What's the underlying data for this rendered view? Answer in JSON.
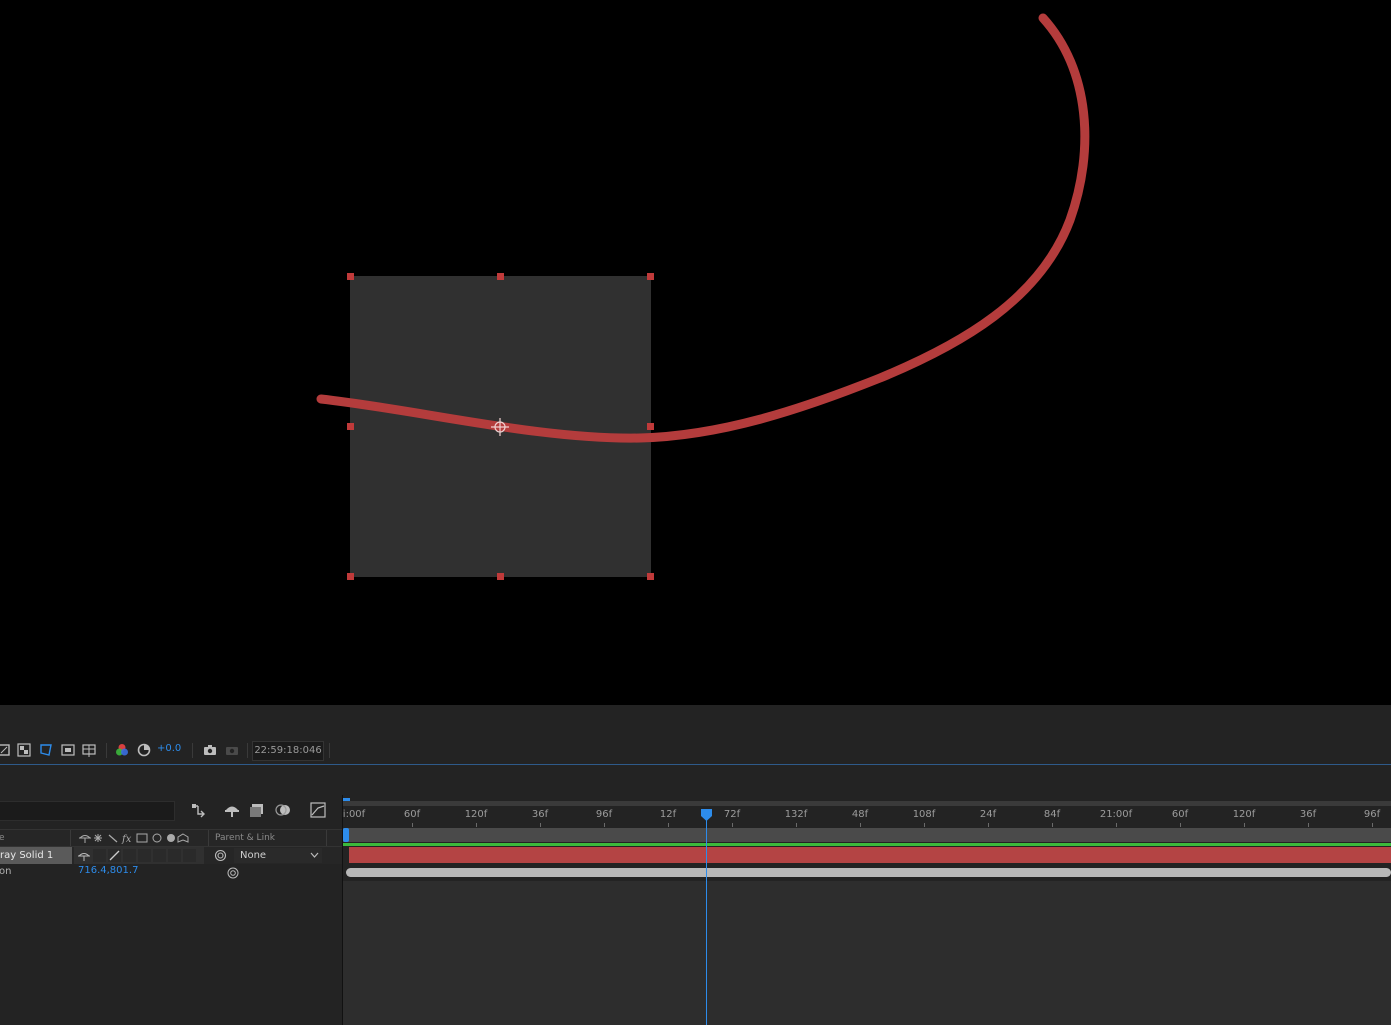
{
  "viewer": {
    "solid_color": "#303030",
    "path_color": "#b43c3c",
    "handle_color": "#c03a3a"
  },
  "toolbar": {
    "icons": [
      "region-of-interest-icon",
      "transparency-grid-icon",
      "mask-visibility-icon",
      "safe-zones-icon",
      "grid-guides-icon",
      "color-channels-icon",
      "reset-exposure-icon",
      "snapshot-icon",
      "show-snapshot-icon"
    ],
    "exposure": "+0.0",
    "timecode": "22:59:18:046"
  },
  "timeline": {
    "accent": "#2d8ceb",
    "columns": {
      "name_partial": "e",
      "parent_link": "Parent & Link"
    },
    "ruler_start": "i:00f",
    "ticks": [
      "60f",
      "120f",
      "36f",
      "96f",
      "12f",
      "72f",
      "132f",
      "48f",
      "108f",
      "24f",
      "84f",
      "21:00f",
      "60f",
      "120f",
      "36f",
      "96f"
    ],
    "layer": {
      "name": "ray Solid 1",
      "parent": "None",
      "bar_color": "#b44444"
    },
    "property": {
      "name_partial": "on",
      "value": "716.4,801.7"
    }
  }
}
